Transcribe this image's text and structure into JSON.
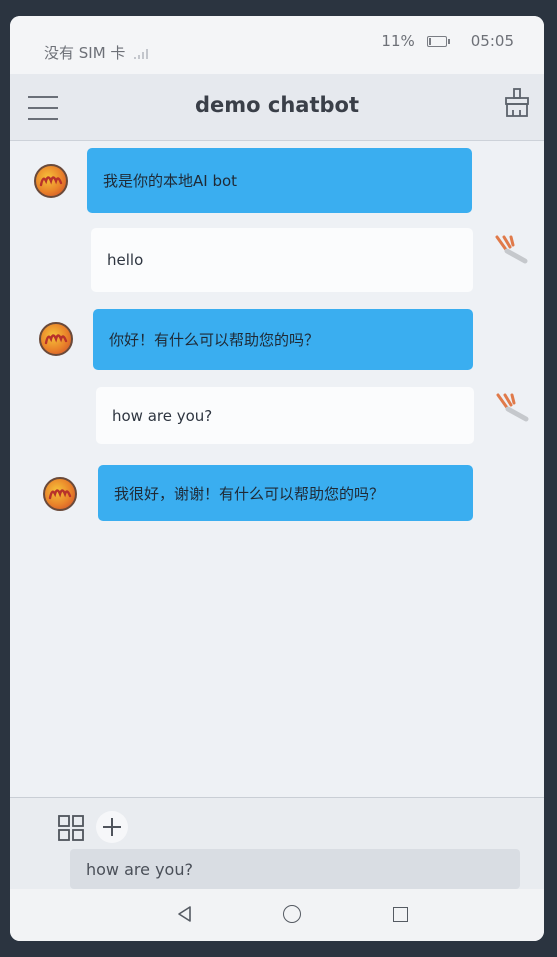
{
  "status_bar": {
    "carrier": "没有 SIM 卡",
    "battery": "11%",
    "battery_level": 0.11,
    "time": "05:05"
  },
  "header": {
    "title": "demo chatbot"
  },
  "messages": [
    {
      "role": "bot",
      "text": "我是你的本地AI bot"
    },
    {
      "role": "user",
      "text": "hello"
    },
    {
      "role": "bot",
      "text": "你好！有什么可以帮助您的吗？"
    },
    {
      "role": "user",
      "text": "how are you?"
    },
    {
      "role": "bot",
      "text": "我很好，谢谢！有什么可以帮助您的吗？"
    }
  ],
  "input": {
    "value": "how are you?"
  },
  "colors": {
    "bot_bubble": "#3aaef0",
    "user_bubble": "#fbfcfd",
    "accent": "#e9822a"
  },
  "icons": {
    "menu": "menu-icon",
    "clear": "broom-icon",
    "grid": "grid-icon",
    "add": "plus-icon",
    "bot_avatar": "bot-avatar-icon",
    "user_avatar": "user-avatar-icon",
    "back": "back-icon",
    "home": "home-icon",
    "recent": "recent-apps-icon"
  }
}
